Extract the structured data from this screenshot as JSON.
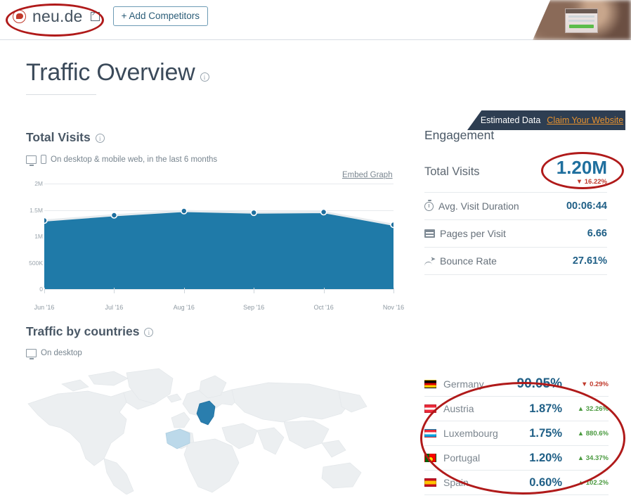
{
  "header": {
    "site_name": "neu.de",
    "logo_icon": "speech-bubble-logo-icon",
    "external_link_icon": "external-link-icon",
    "add_competitors_label": "+ Add Competitors"
  },
  "ribbon": {
    "estimated_label": "Estimated Data",
    "claim_link": "Claim Your Website"
  },
  "page": {
    "title": "Traffic Overview"
  },
  "total_visits_section": {
    "heading": "Total Visits",
    "subtitle": "On desktop & mobile web, in the last 6 months",
    "embed_link": "Embed Graph"
  },
  "chart_data": {
    "type": "area",
    "title": "Total Visits",
    "xlabel": "",
    "ylabel": "",
    "categories": [
      "Jun '16",
      "Jul '16",
      "Aug '16",
      "Sep '16",
      "Oct '16",
      "Nov '16"
    ],
    "values": [
      1300000,
      1400000,
      1480000,
      1450000,
      1460000,
      1220000
    ],
    "ytick_labels": [
      "0",
      "500K",
      "1M",
      "1.5M",
      "2M"
    ],
    "ytick_values": [
      0,
      500000,
      1000000,
      1500000,
      2000000
    ],
    "ylim": [
      0,
      2000000
    ],
    "grid": true,
    "legend": "none",
    "series_color": "#1f7aa8",
    "line_color": "#e6ebee",
    "marker_color": "#1f6f9e"
  },
  "engagement": {
    "heading": "Engagement",
    "total_visits_label": "Total Visits",
    "total_visits_value": "1.20M",
    "total_visits_delta": "16.22%",
    "total_visits_delta_dir": "down",
    "rows": [
      {
        "icon": "stopwatch-icon",
        "label": "Avg. Visit Duration",
        "value": "00:06:44"
      },
      {
        "icon": "pages-icon",
        "label": "Pages per Visit",
        "value": "6.66"
      },
      {
        "icon": "bounce-arrow-icon",
        "label": "Bounce Rate",
        "value": "27.61%"
      }
    ]
  },
  "traffic_by_countries": {
    "heading": "Traffic by countries",
    "subtitle": "On desktop",
    "map": {
      "highlight_primary": "Germany",
      "highlight_primary_color": "#2a7eae",
      "highlight_secondary_color": "#bcd9ea",
      "base_color": "#eceff1"
    },
    "countries": [
      {
        "flag": "flag-germany-icon",
        "name": "Germany",
        "value": "90.05%",
        "delta": "0.29%",
        "dir": "down"
      },
      {
        "flag": "flag-austria-icon",
        "name": "Austria",
        "value": "1.87%",
        "delta": "32.26%",
        "dir": "up"
      },
      {
        "flag": "flag-luxembourg-icon",
        "name": "Luxembourg",
        "value": "1.75%",
        "delta": "880.6%",
        "dir": "up"
      },
      {
        "flag": "flag-portugal-icon",
        "name": "Portugal",
        "value": "1.20%",
        "delta": "34.37%",
        "dir": "up"
      },
      {
        "flag": "flag-spain-icon",
        "name": "Spain",
        "value": "0.60%",
        "delta": "102.2%",
        "dir": "up"
      }
    ]
  },
  "colors": {
    "accent_blue": "#1f6f9e",
    "chart_fill": "#1f7aa8",
    "ribbon_bg": "#2e3e52",
    "claim_orange": "#e8922e",
    "positive_green": "#4a9a3f",
    "negative_red": "#c0392b",
    "annotation_red": "#b01a1a"
  }
}
